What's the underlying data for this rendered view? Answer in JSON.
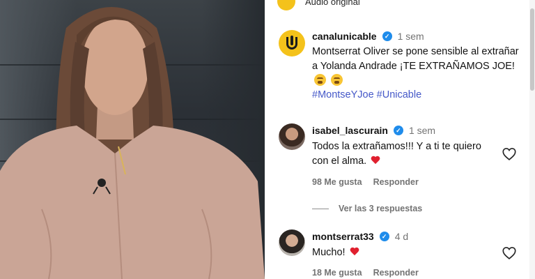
{
  "audio": {
    "label": "Audio original"
  },
  "post": {
    "username": "canalunicable",
    "time": "1 sem",
    "caption": "Montserrat Oliver se pone sensible al extrañar a Yolanda Andrade ¡TE EXTRAÑAMOS JOE!",
    "caption_emojis": [
      "sad-face-emoji",
      "fearful-face-emoji"
    ],
    "hashtags": [
      "#MontseYJoe",
      "#Unicable"
    ]
  },
  "comments": [
    {
      "username": "isabel_lascurain",
      "time": "1 sem",
      "text": "Todos la extrañamos!!! Y a ti te quiero con el alma.",
      "likes": "98 Me gusta",
      "reply_label": "Responder",
      "view_replies": "Ver las 3 respuestas"
    },
    {
      "username": "montserrat33",
      "time": "4 d",
      "text": "Mucho!",
      "likes": "18 Me gusta",
      "reply_label": "Responder"
    }
  ],
  "colors": {
    "brand_yellow": "#f4c21b",
    "verified_blue": "#1f8ceb",
    "hashtag_blue": "#4558c8",
    "heart_red": "#e0202f"
  },
  "icons": [
    "music-logo-icon",
    "verified-icon",
    "heart-outline-icon",
    "heart-emoji-icon"
  ]
}
